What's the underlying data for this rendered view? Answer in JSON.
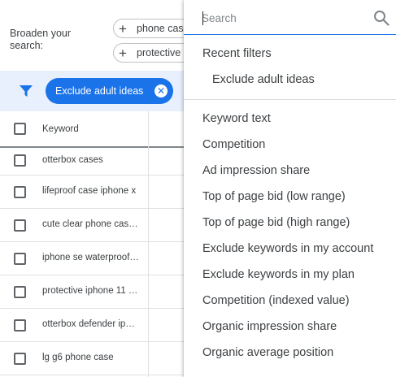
{
  "broaden": {
    "label": "Broaden your search:",
    "chips": [
      "phone cas",
      "protective"
    ]
  },
  "filter_bar": {
    "active_filter": "Exclude adult ideas"
  },
  "table": {
    "header": "Keyword",
    "rows": [
      "otterbox cases",
      "lifeproof case iphone x",
      "cute clear phone cas…",
      "iphone se waterproof…",
      "protective iphone 11 …",
      "otterbox defender ip…",
      "lg g6 phone case"
    ]
  },
  "dropdown": {
    "search_placeholder": "Search",
    "recent_title": "Recent filters",
    "recent_items": [
      "Exclude adult ideas"
    ],
    "items": [
      "Keyword text",
      "Competition",
      "Ad impression share",
      "Top of page bid (low range)",
      "Top of page bid (high range)",
      "Exclude keywords in my account",
      "Exclude keywords in my plan",
      "Competition (indexed value)",
      "Organic impression share",
      "Organic average position"
    ]
  },
  "colors": {
    "accent": "#1a73e8",
    "filter_bar_bg": "#e8f0fe",
    "text": "#3c4043"
  }
}
